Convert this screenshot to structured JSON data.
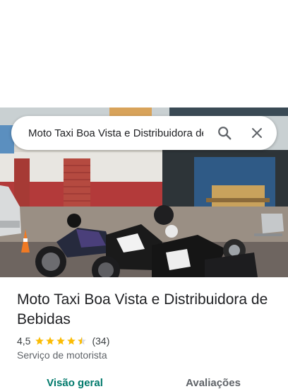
{
  "search": {
    "query": "Moto Taxi Boa Vista e Distribuidora de Bebidas"
  },
  "place": {
    "name": "Moto Taxi Boa Vista e Distribuidora de Bebidas",
    "rating": "4,5",
    "rating_value": 4.5,
    "review_count": "(34)",
    "category": "Serviço de motorista"
  },
  "tabs": [
    {
      "label": "Visão geral",
      "active": true
    },
    {
      "label": "Avaliações",
      "active": false
    }
  ],
  "colors": {
    "star": "#fbbc04",
    "active_tab": "#00796b"
  }
}
